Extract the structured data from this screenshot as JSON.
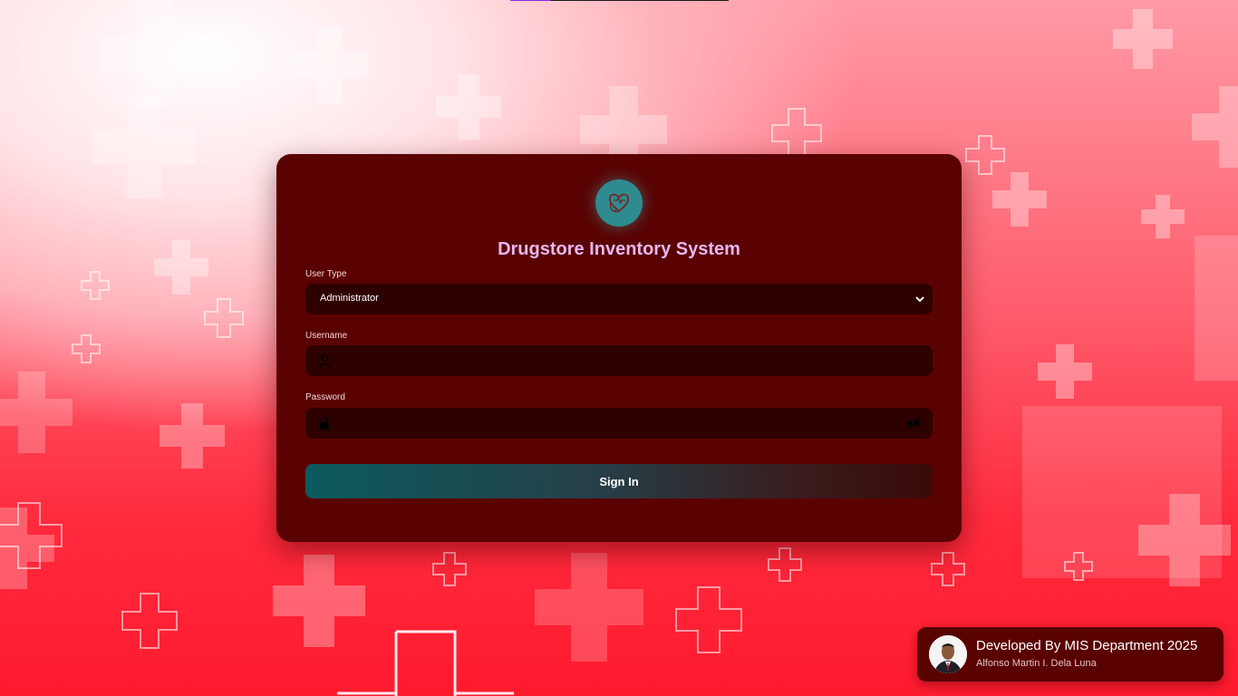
{
  "app": {
    "title": "Drugstore Inventory System",
    "logo_icon": "heart-stethoscope-icon"
  },
  "form": {
    "user_type": {
      "label": "User Type",
      "selected": "Administrator",
      "options": [
        "Administrator"
      ]
    },
    "username": {
      "label": "Username",
      "value": "",
      "icon": "user-icon"
    },
    "password": {
      "label": "Password",
      "value": "",
      "icon": "lock-icon",
      "toggle_icon": "eye-slash-icon"
    },
    "submit_label": "Sign In"
  },
  "footer": {
    "developer_title": "Developed By MIS Department 2025",
    "developer_name": "Alfonso Martin I. Dela Luna"
  },
  "colors": {
    "card": "#5a0202",
    "field": "#2e0101",
    "title": "#e7b7f0",
    "logo": "#2e8b8f",
    "button_start": "#0b5b5e",
    "button_end": "#3a0909"
  }
}
